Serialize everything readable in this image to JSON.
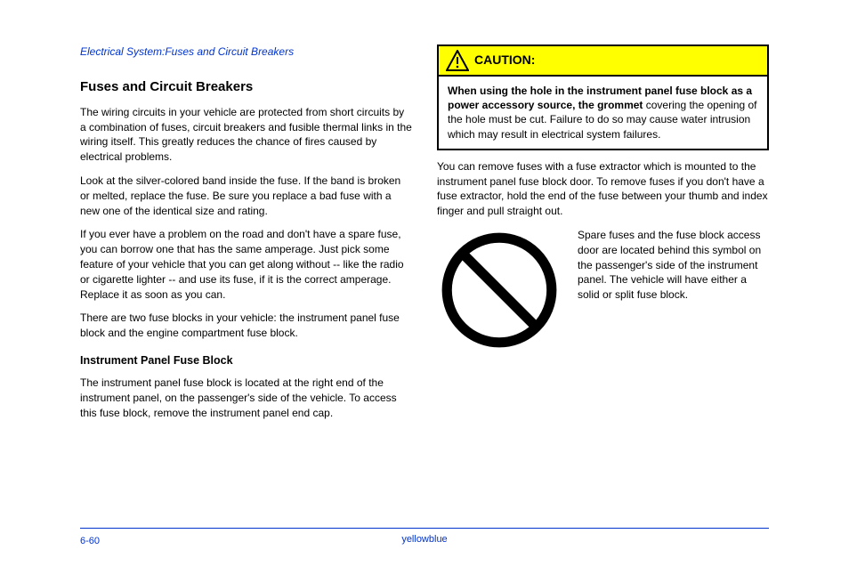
{
  "left": {
    "keywords": "Electrical System:Fuses and Circuit Breakers",
    "title": "Fuses and Circuit Breakers",
    "p1": "The wiring circuits in your vehicle are protected from short circuits by a combination of fuses, circuit breakers and fusible thermal links in the wiring itself. This greatly reduces the chance of fires caused by electrical problems.",
    "p2": "Look at the silver-colored band inside the fuse. If the band is broken or melted, replace the fuse. Be sure you replace a bad fuse with a new one of the identical size and rating.",
    "p3": "If you ever have a problem on the road and don't have a spare fuse, you can borrow one that has the same amperage. Just pick some feature of your vehicle that you can get along without -- like the radio or cigarette lighter -- and use its fuse, if it is the correct amperage. Replace it as soon as you can.",
    "p4": "There are two fuse blocks in your vehicle: the instrument panel fuse block and the engine compartment fuse block.",
    "sub": "Instrument Panel Fuse Block",
    "p5": "The instrument panel fuse block is located at the right end of the instrument panel, on the passenger's side of the vehicle. To access this fuse block, remove the instrument panel end cap."
  },
  "right": {
    "caution_label": "CAUTION:",
    "caution_body_bold": "When using the hole in the instrument panel fuse block as a power accessory source, the grommet",
    "caution_body_rest": " covering the opening of the hole must be cut. Failure to do so may cause water intrusion which may result in electrical system failures.",
    "p1": "You can remove fuses with a fuse extractor which is mounted to the instrument panel fuse block door. To remove fuses if you don't have a fuse extractor, hold the end of the fuse between your thumb and index finger and pull straight out.",
    "sym_text": "Spare fuses and the fuse block access door are located behind this symbol on the passenger's side of the instrument panel. The vehicle will have either a solid or split fuse block."
  },
  "footer": {
    "page": "6-60",
    "link": "yellowblue"
  }
}
